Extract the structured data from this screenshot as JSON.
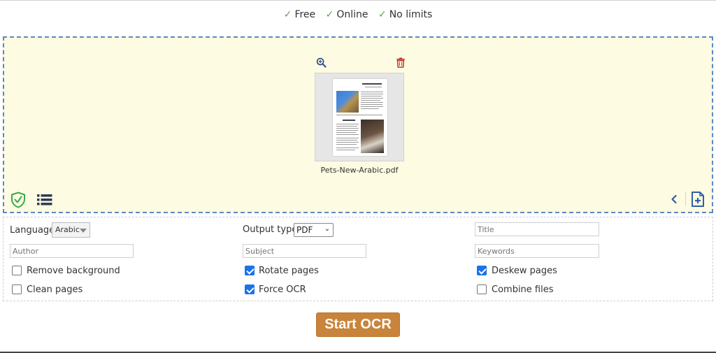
{
  "features": [
    {
      "label": "Free"
    },
    {
      "label": "Online"
    },
    {
      "label": "No limits"
    }
  ],
  "file": {
    "name": "Pets-New-Arabic.pdf"
  },
  "icons": {
    "zoom": "zoom-in-icon",
    "delete": "trash-icon",
    "shield": "shield-check-icon",
    "list": "list-icon",
    "prev": "chevron-left-icon",
    "add": "add-file-icon"
  },
  "options": {
    "language_label": "Language",
    "language_value": "Arabic",
    "output_label": "Output type",
    "output_value": "PDF",
    "title_placeholder": "Title",
    "author_placeholder": "Author",
    "subject_placeholder": "Subject",
    "keywords_placeholder": "Keywords",
    "checkboxes": [
      {
        "label": "Remove background",
        "checked": false
      },
      {
        "label": "Rotate pages",
        "checked": true
      },
      {
        "label": "Deskew pages",
        "checked": true
      },
      {
        "label": "Clean pages",
        "checked": false
      },
      {
        "label": "Force OCR",
        "checked": true
      },
      {
        "label": "Combine files",
        "checked": false
      }
    ]
  },
  "actions": {
    "start_label": "Start OCR"
  },
  "colors": {
    "accent": "#c8843a",
    "dropzone_bg": "#fefbe3",
    "dropzone_border": "#5b88c8",
    "check_green": "#5aa84a",
    "checkbox_blue": "#1a73e8"
  }
}
